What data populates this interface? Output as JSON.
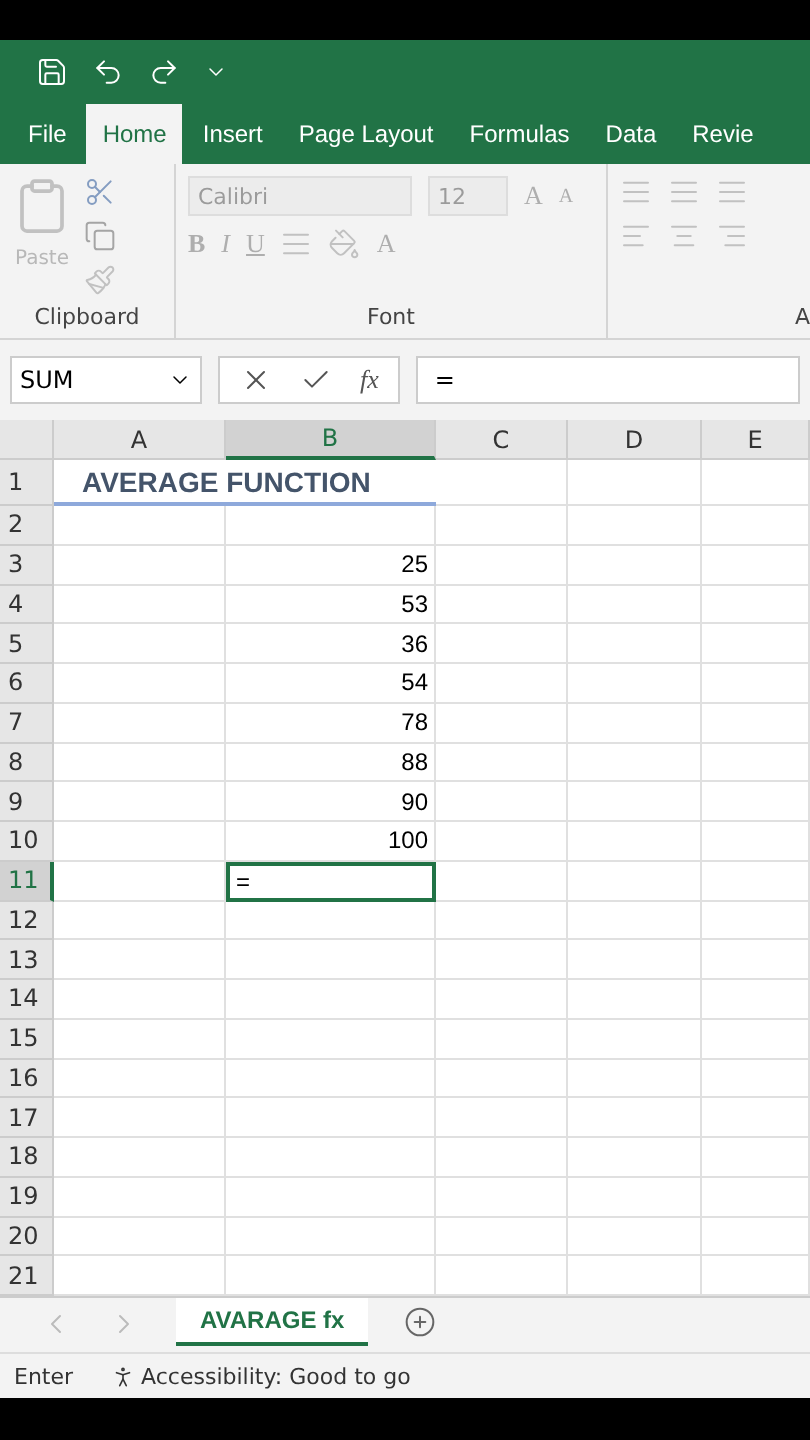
{
  "tabs": [
    {
      "label": "File",
      "selected": false
    },
    {
      "label": "Home",
      "selected": true
    },
    {
      "label": "Insert",
      "selected": false
    },
    {
      "label": "Page Layout",
      "selected": false
    },
    {
      "label": "Formulas",
      "selected": false
    },
    {
      "label": "Data",
      "selected": false
    },
    {
      "label": "Revie",
      "selected": false
    }
  ],
  "ribbon": {
    "disabled": true,
    "clipboard": {
      "label": "Clipboard",
      "paste": "Paste"
    },
    "font": {
      "label": "Font",
      "font_name": "Calibri",
      "font_size": "12",
      "grow": "A",
      "shrink": "A",
      "bold": "B",
      "italic": "I",
      "underline": "U",
      "font_color_letter": "A"
    },
    "alignment": {
      "label": "A"
    }
  },
  "formula_bar": {
    "name_box": "SUM",
    "fx": "fx",
    "value": "="
  },
  "columns": [
    {
      "label": "A",
      "selected": false
    },
    {
      "label": "B",
      "selected": true
    },
    {
      "label": "C",
      "selected": false
    },
    {
      "label": "D",
      "selected": false
    },
    {
      "label": "E",
      "selected": false
    }
  ],
  "rows": [
    {
      "label": "1",
      "selected": false,
      "kind": "title",
      "text": "AVERAGE FUNCTION"
    },
    {
      "label": "2",
      "selected": false
    },
    {
      "label": "3",
      "selected": false,
      "kind": "number",
      "text": "25"
    },
    {
      "label": "4",
      "selected": false,
      "kind": "number",
      "text": "53"
    },
    {
      "label": "5",
      "selected": false,
      "kind": "number",
      "text": "36"
    },
    {
      "label": "6",
      "selected": false,
      "kind": "number",
      "text": "54"
    },
    {
      "label": "7",
      "selected": false,
      "kind": "number",
      "text": "78"
    },
    {
      "label": "8",
      "selected": false,
      "kind": "number",
      "text": "88"
    },
    {
      "label": "9",
      "selected": false,
      "kind": "number",
      "text": "90"
    },
    {
      "label": "10",
      "selected": false,
      "kind": "number",
      "text": "100"
    },
    {
      "label": "11",
      "selected": true,
      "kind": "input",
      "text": "="
    },
    {
      "label": "12",
      "selected": false
    },
    {
      "label": "13",
      "selected": false
    },
    {
      "label": "14",
      "selected": false
    },
    {
      "label": "15",
      "selected": false
    },
    {
      "label": "16",
      "selected": false
    },
    {
      "label": "17",
      "selected": false
    },
    {
      "label": "18",
      "selected": false
    },
    {
      "label": "19",
      "selected": false
    },
    {
      "label": "20",
      "selected": false
    },
    {
      "label": "21",
      "selected": false
    }
  ],
  "sheet_tabs": [
    {
      "label": "AVARAGE fx",
      "selected": true
    }
  ],
  "status_bar": {
    "mode": "Enter",
    "accessibility": "Accessibility: Good to go"
  }
}
